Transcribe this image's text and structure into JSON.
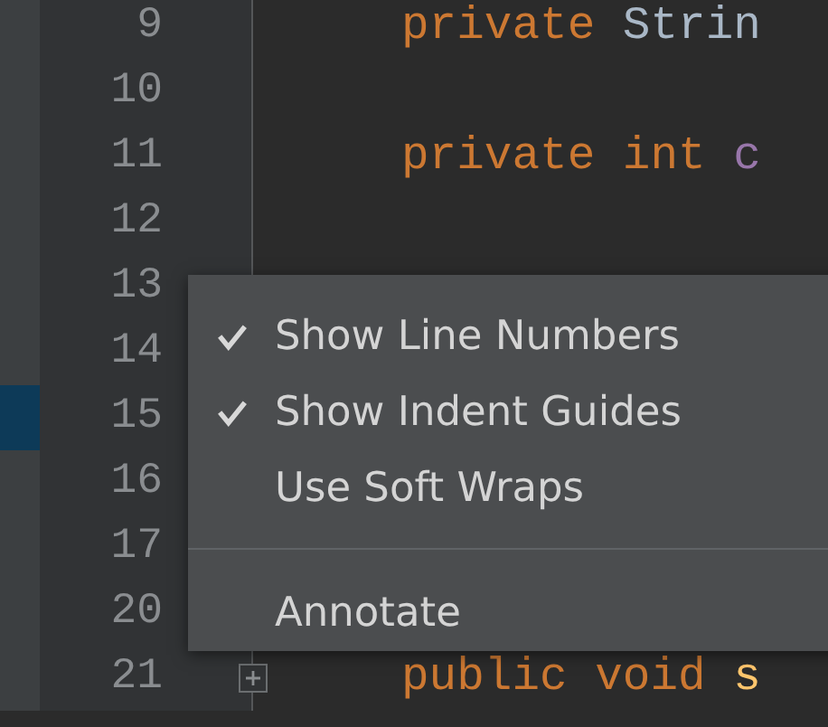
{
  "lines": [
    {
      "number": "9",
      "strip_selected": false,
      "folded": false,
      "code": [
        {
          "text": "private ",
          "kind": "keyword"
        },
        {
          "text": "Strin",
          "kind": "plain"
        }
      ]
    },
    {
      "number": "10",
      "strip_selected": false,
      "folded": false
    },
    {
      "number": "11",
      "strip_selected": false,
      "folded": false,
      "code": [
        {
          "text": "private int ",
          "kind": "keyword"
        },
        {
          "text": "c",
          "kind": "field"
        }
      ]
    },
    {
      "number": "12",
      "strip_selected": false,
      "folded": false
    },
    {
      "number": "13",
      "strip_selected": false,
      "folded": false
    },
    {
      "number": "14",
      "strip_selected": false,
      "folded": false
    },
    {
      "number": "15",
      "strip_selected": true,
      "folded": false
    },
    {
      "number": "16",
      "strip_selected": false,
      "folded": false
    },
    {
      "number": "17",
      "strip_selected": false,
      "folded": false
    },
    {
      "number": "20",
      "strip_selected": false,
      "folded": false
    },
    {
      "number": "21",
      "strip_selected": false,
      "folded": true,
      "code": [
        {
          "text": "public void ",
          "kind": "keyword"
        },
        {
          "text": "s",
          "kind": "method"
        }
      ]
    }
  ],
  "context_menu": {
    "items": [
      {
        "kind": "check",
        "label": "Show Line Numbers",
        "checked": true
      },
      {
        "kind": "check",
        "label": "Show Indent Guides",
        "checked": true
      },
      {
        "kind": "check",
        "label": "Use Soft Wraps",
        "checked": false
      },
      {
        "kind": "separator"
      },
      {
        "kind": "action",
        "label": "Annotate"
      }
    ]
  }
}
